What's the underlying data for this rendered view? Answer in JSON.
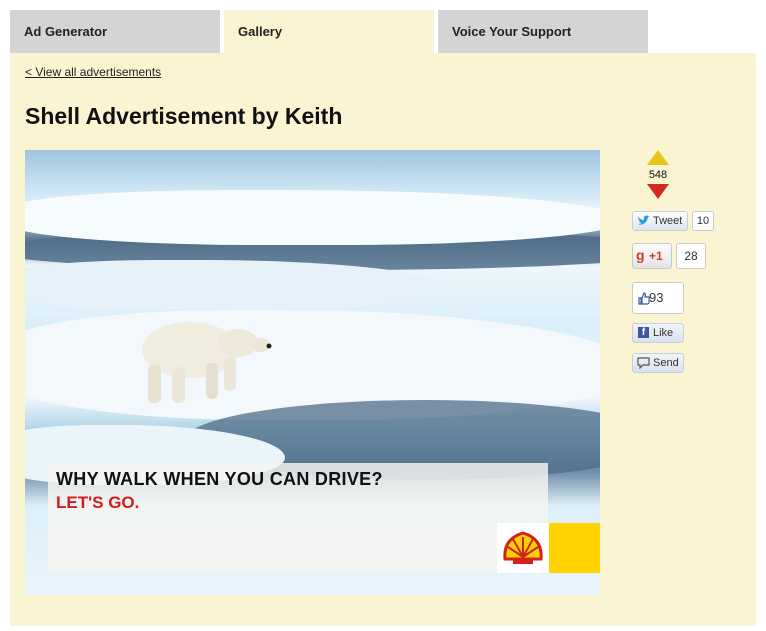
{
  "tabs": [
    {
      "label": "Ad Generator",
      "active": false
    },
    {
      "label": "Gallery",
      "active": true
    },
    {
      "label": "Voice Your Support",
      "active": false
    }
  ],
  "back_link": "< View all advertisements",
  "page_title": "Shell Advertisement by Keith",
  "ad": {
    "headline": "WHY WALK WHEN YOU CAN DRIVE?",
    "tagline": "LET'S GO.",
    "logo_icon": "shell-logo-icon",
    "accent_color": "#ffd200",
    "tagline_color": "#d21b1b"
  },
  "votes": {
    "count": "548",
    "up_color": "#e8c31a",
    "down_color": "#d12a1e"
  },
  "social": {
    "tweet_label": "Tweet",
    "tweet_count": "10",
    "gplus_label": "+1",
    "gplus_count": "28",
    "like_count": "93",
    "like_label": "Like",
    "send_label": "Send"
  },
  "colors": {
    "panel_bg": "#faf4d3",
    "inactive_tab_bg": "#d4d4d4"
  }
}
